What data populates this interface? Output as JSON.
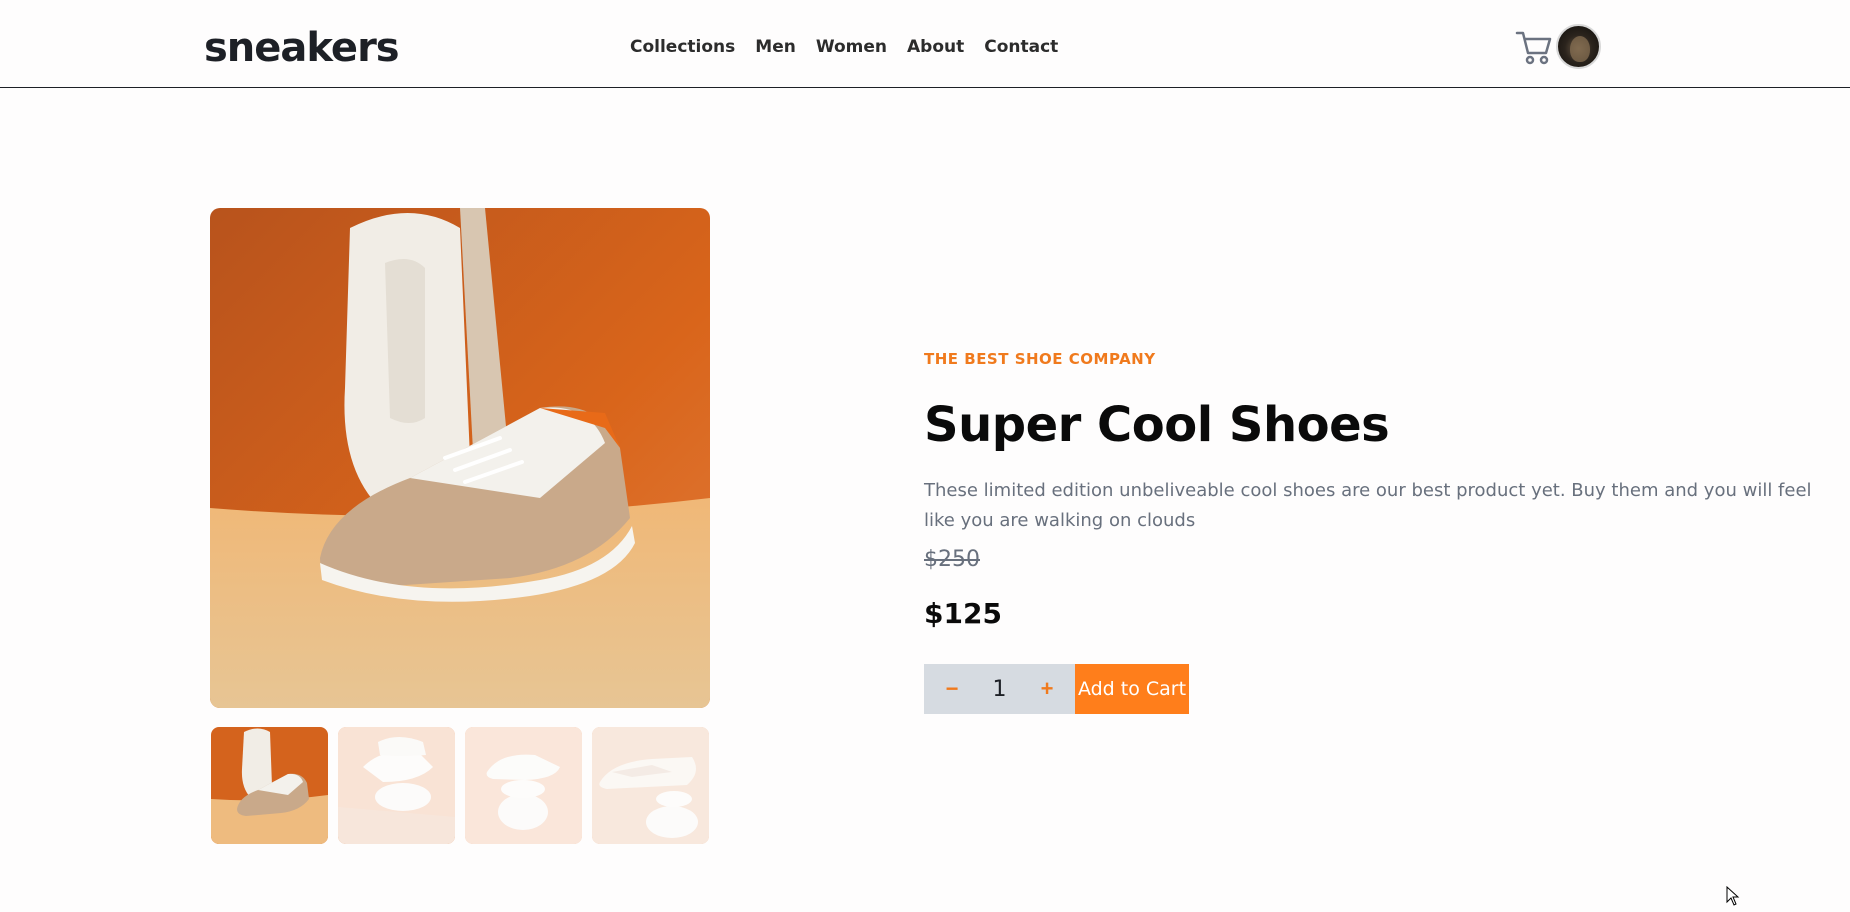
{
  "header": {
    "logo": "sneakers",
    "nav": [
      "Collections",
      "Men",
      "Women",
      "About",
      "Contact"
    ]
  },
  "product": {
    "company": "THE BEST SHOE COMPANY",
    "title": "Super Cool Shoes",
    "description": "These limited edition unbeliveable cool shoes are our best product yet. Buy them and you will feel like you are walking on clouds",
    "old_price": "$250",
    "price": "$125",
    "quantity": "1",
    "minus": "−",
    "plus": "+",
    "add_to_cart": "Add to Cart"
  },
  "colors": {
    "accent": "#ff7e1b",
    "text": "#1d2026",
    "muted": "#68707d"
  },
  "icons": {
    "cart": "cart-icon",
    "avatar": "avatar"
  }
}
